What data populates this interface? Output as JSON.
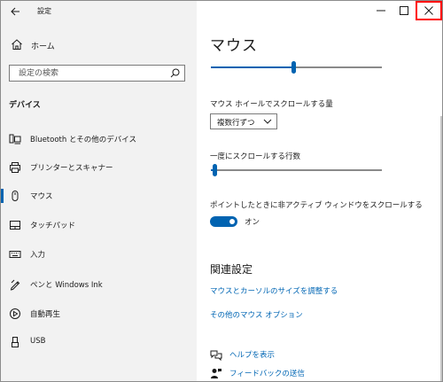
{
  "window": {
    "title": "設定",
    "controls": [
      "minimize",
      "maximize",
      "close"
    ]
  },
  "sidebar": {
    "home_label": "ホーム",
    "search_placeholder": "設定の検索",
    "section_title": "デバイス",
    "items": [
      {
        "label": "Bluetooth とその他のデバイス",
        "icon": "bluetooth-devices-icon"
      },
      {
        "label": "プリンターとスキャナー",
        "icon": "printer-icon"
      },
      {
        "label": "マウス",
        "icon": "mouse-icon",
        "active": true
      },
      {
        "label": "タッチパッド",
        "icon": "touchpad-icon"
      },
      {
        "label": "入力",
        "icon": "keyboard-icon"
      },
      {
        "label": "ペンと Windows Ink",
        "icon": "pen-icon"
      },
      {
        "label": "自動再生",
        "icon": "autoplay-icon"
      },
      {
        "label": "USB",
        "icon": "usb-icon"
      }
    ]
  },
  "main": {
    "page_title": "マウス",
    "cursor_speed_slider": {
      "value": 0.48
    },
    "scroll_amount_label": "マウス ホイールでスクロールする量",
    "scroll_amount_value": "複数行ずつ",
    "lines_label": "一度にスクロールする行数",
    "lines_slider": {
      "value": 0.02
    },
    "inactive_scroll_label": "ポイントしたときに非アクティブ ウィンドウをスクロールする",
    "inactive_scroll_state": "オン",
    "related_title": "関連設定",
    "related_links": [
      "マウスとカーソルのサイズを調整する",
      "その他のマウス オプション"
    ],
    "help_links": [
      {
        "label": "ヘルプを表示",
        "icon": "help-chat-icon"
      },
      {
        "label": "フィードバックの送信",
        "icon": "feedback-icon"
      }
    ]
  },
  "colors": {
    "accent": "#0063b1",
    "link": "#0066b4",
    "sidebar_bg": "#f2f2f2",
    "close_highlight": "#ff0000"
  }
}
